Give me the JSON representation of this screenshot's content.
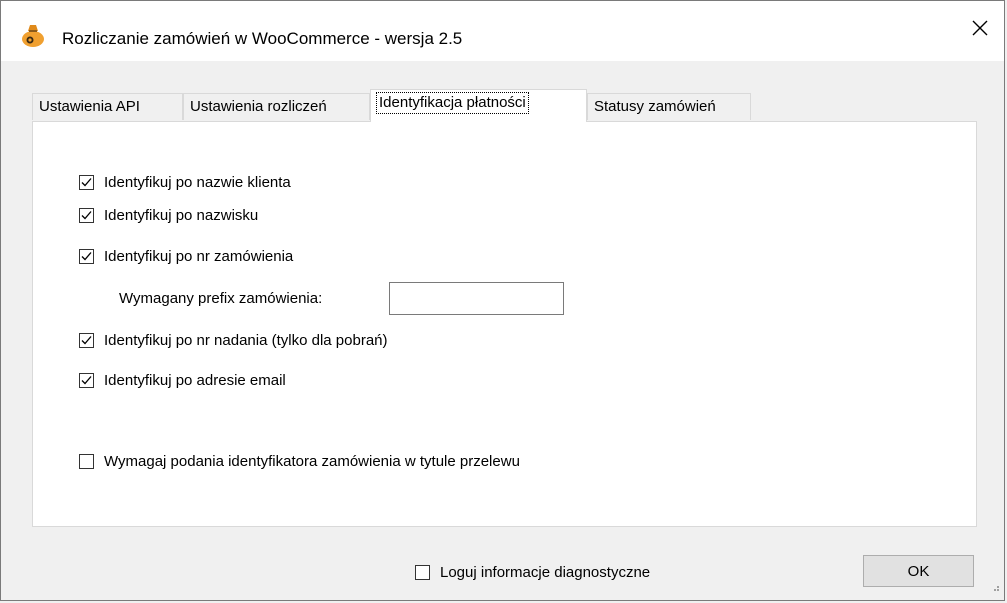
{
  "window": {
    "title": "Rozliczanie zamówień w WooCommerce - wersja 2.5",
    "close_glyph": "✕",
    "icon": "money-bag-icon"
  },
  "tabs": [
    {
      "label": "Ustawienia API",
      "active": false
    },
    {
      "label": "Ustawienia rozliczeń",
      "active": false
    },
    {
      "label": "Identyfikacja płatności",
      "active": true
    },
    {
      "label": "Statusy zamówień",
      "active": false
    }
  ],
  "identification": {
    "by_client_name": {
      "label": "Identyfikuj po nazwie klienta",
      "checked": true
    },
    "by_surname": {
      "label": "Identyfikuj po nazwisku",
      "checked": true
    },
    "by_order_number": {
      "label": "Identyfikuj po nr zamówienia",
      "checked": true
    },
    "prefix": {
      "label": "Wymagany prefix zamówienia:",
      "value": ""
    },
    "by_tracking_number": {
      "label": "Identyfikuj po nr nadania (tylko dla pobrań)",
      "checked": true
    },
    "by_email": {
      "label": "Identyfikuj po adresie email",
      "checked": true
    },
    "require_order_id": {
      "label": "Wymagaj podania identyfikatora zamówienia w tytule przelewu",
      "checked": false
    }
  },
  "footer": {
    "diagnostics": {
      "label": "Loguj informacje diagnostyczne",
      "checked": false
    },
    "ok_label": "OK"
  },
  "colors": {
    "title_bar": "#ffffff",
    "dialog_bg": "#f0f0f0",
    "panel_bg": "#ffffff",
    "button_bg": "#e1e1e1",
    "icon_bag": "#f0a030"
  }
}
